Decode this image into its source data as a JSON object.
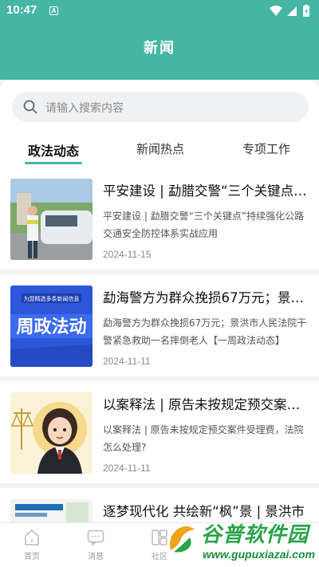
{
  "status_bar": {
    "time": "10:47",
    "notification_icon": "A"
  },
  "header": {
    "title": "新闻"
  },
  "search": {
    "placeholder": "请输入搜索内容"
  },
  "tabs": [
    {
      "label": "政法动态",
      "active": true
    },
    {
      "label": "新闻热点",
      "active": false
    },
    {
      "label": "专项工作",
      "active": false
    }
  ],
  "articles": [
    {
      "title": "平安建设 | 勐腊交警“三个关键点”持续强化公路交通安全防控体系实战应用",
      "summary": "平安建设 | 勐腊交警“三个关键点”持续强化公路交通安全防控体系实战应用",
      "date": "2024-11-15"
    },
    {
      "title": "勐海警方为群众挽损67万元；景洪市人民法院干警紧急救助一名摔倒老人",
      "summary": "勐海警方为群众挽损67万元；景洪市人民法院干警紧急救助一名摔倒老人【一周政法动态】",
      "date": "2024-11-11",
      "thumb_banner": "为您精选多条新闻信息",
      "thumb_text": "周政法动"
    },
    {
      "title": "以案释法 | 原告未按规定预交案件受理费，法院怎么处理？",
      "summary": "以案释法 | 原告未按规定预交案件受理费，法院怎么处理?",
      "date": "2024-11-11"
    },
    {
      "title": "逐梦现代化 共绘新“枫”景 | 景洪市",
      "summary": "",
      "date": ""
    }
  ],
  "bottom_nav": [
    {
      "label": "首页",
      "icon": "home-icon"
    },
    {
      "label": "消息",
      "icon": "message-icon"
    },
    {
      "label": "社区",
      "icon": "community-icon"
    }
  ],
  "watermark": {
    "title": "谷普软件园",
    "url": "www.gupuxiazai.com"
  },
  "colors": {
    "accent": "#45b5a4",
    "background": "#f2f3f5"
  }
}
